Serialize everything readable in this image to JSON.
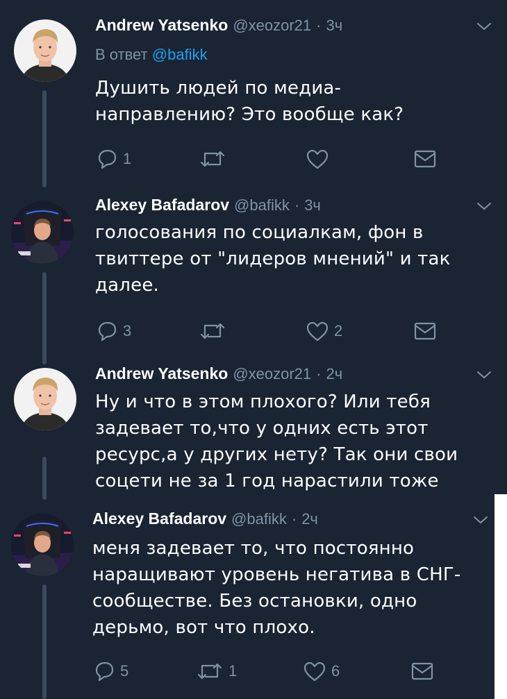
{
  "colors": {
    "background": "#1a2433",
    "muted": "#8193a5",
    "link": "#1da1f2",
    "thread_line": "#3b4a5c"
  },
  "tweets": [
    {
      "author": "Andrew Yatsenko",
      "handle": "@xeozor21",
      "separator": "·",
      "time": "3ч",
      "reply_prefix": "В ответ",
      "reply_handle": "@bafikk",
      "lines": [
        "Душить людей по медиа-",
        "направлению? Это вообще как?"
      ],
      "replies": "1",
      "retweets": "",
      "likes": "",
      "avatar_icon": "avatar-blonde-man"
    },
    {
      "author": "Alexey Bafadarov",
      "handle": "@bafikk",
      "separator": "·",
      "time": "3ч",
      "lines": [
        "голосования по социалкам, фон в",
        "твиттере от \"лидеров мнений\" и так",
        "далее."
      ],
      "replies": "3",
      "retweets": "",
      "likes": "2",
      "avatar_icon": "avatar-gamer-chair"
    },
    {
      "author": "Andrew Yatsenko",
      "handle": "@xeozor21",
      "separator": "·",
      "time": "2ч",
      "lines": [
        "Ну и что в этом плохого? Или тебя",
        "задевает то,что у одних есть этот",
        "ресурс,а у других нету? Так они свои",
        "соцети не за 1 год нарастили тоже"
      ],
      "replies": "",
      "retweets": "",
      "likes": "",
      "avatar_icon": "avatar-blonde-man"
    },
    {
      "author": "Alexey Bafadarov",
      "handle": "@bafikk",
      "separator": "·",
      "time": "2ч",
      "lines": [
        "меня задевает то, что постоянно",
        "наращивают уровень негатива в СНГ-",
        "сообществе. Без остановки, одно",
        "дерьмо, вот что плохо."
      ],
      "replies": "5",
      "retweets": "1",
      "likes": "6",
      "avatar_icon": "avatar-gamer-chair"
    }
  ]
}
